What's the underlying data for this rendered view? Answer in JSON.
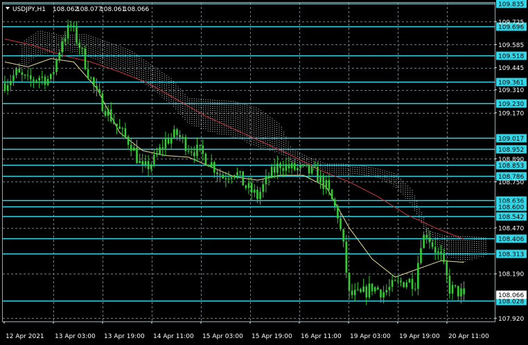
{
  "header": {
    "symbol_label": "USDJPY,H1",
    "ohlc": [
      "108.062",
      "108.077",
      "108.061",
      "108.066"
    ]
  },
  "colors": {
    "background": "#000000",
    "candles": "#33cc33",
    "grid": "#6e7f7f",
    "level_line": "#33d6e6",
    "level_label_bg": "#33d6e6",
    "price_label_bg": "#ffffff",
    "cloud": "#ffffff",
    "ma_fast": "#e8df8e",
    "ma_slow": "#cc3344"
  },
  "chart_data": {
    "type": "candlestick",
    "title": "",
    "xlabel": "",
    "ylabel": "",
    "ylim": [
      107.9,
      109.84
    ],
    "grid": true,
    "y_ticks": [
      "109.725",
      "109.585",
      "109.445",
      "109.310",
      "109.170",
      "108.890",
      "108.750",
      "108.470",
      "108.190",
      "107.920"
    ],
    "x_ticks": [
      "12 Apr 2021",
      "13 Apr 03:00",
      "13 Apr 19:00",
      "14 Apr 11:00",
      "15 Apr 03:00",
      "15 Apr 19:00",
      "16 Apr 11:00",
      "19 Apr 03:00",
      "19 Apr 19:00",
      "20 Apr 11:00"
    ],
    "levels": [
      {
        "label": "109.835",
        "value": 109.835
      },
      {
        "label": "109.696",
        "value": 109.696
      },
      {
        "label": "109.518",
        "value": 109.518
      },
      {
        "label": "109.361",
        "value": 109.361
      },
      {
        "label": "109.230",
        "value": 109.23
      },
      {
        "label": "109.017",
        "value": 109.017
      },
      {
        "label": "108.952",
        "value": 108.952
      },
      {
        "label": "108.853",
        "value": 108.853
      },
      {
        "label": "108.786",
        "value": 108.786
      },
      {
        "label": "108.636",
        "value": 108.636
      },
      {
        "label": "108.600",
        "value": 108.6
      },
      {
        "label": "108.542",
        "value": 108.542
      },
      {
        "label": "108.406",
        "value": 108.406
      },
      {
        "label": "108.313",
        "value": 108.313
      },
      {
        "label": "108.028",
        "value": 108.028
      }
    ],
    "current_price": {
      "label": "108.066",
      "value": 108.066
    },
    "close_path": [
      [
        0,
        109.35
      ],
      [
        4,
        109.41
      ],
      [
        8,
        109.36
      ],
      [
        12,
        109.39
      ],
      [
        16,
        109.37
      ],
      [
        20,
        109.62
      ],
      [
        23,
        109.7
      ],
      [
        26,
        109.58
      ],
      [
        29,
        109.42
      ],
      [
        32,
        109.28
      ],
      [
        36,
        109.17
      ],
      [
        40,
        109.06
      ],
      [
        44,
        108.98
      ],
      [
        48,
        108.82
      ],
      [
        52,
        108.88
      ],
      [
        56,
        109.0
      ],
      [
        60,
        109.04
      ],
      [
        64,
        108.96
      ],
      [
        68,
        108.93
      ],
      [
        72,
        108.86
      ],
      [
        76,
        108.78
      ],
      [
        80,
        108.82
      ],
      [
        84,
        108.72
      ],
      [
        88,
        108.66
      ],
      [
        92,
        108.78
      ],
      [
        96,
        108.86
      ],
      [
        100,
        108.83
      ],
      [
        104,
        108.82
      ],
      [
        108,
        108.8
      ],
      [
        112,
        108.72
      ],
      [
        116,
        108.55
      ],
      [
        118,
        108.35
      ],
      [
        120,
        108.06
      ],
      [
        124,
        108.06
      ],
      [
        128,
        108.11
      ],
      [
        132,
        108.08
      ],
      [
        136,
        108.12
      ],
      [
        140,
        108.15
      ],
      [
        143,
        108.14
      ],
      [
        145,
        108.39
      ],
      [
        147,
        108.44
      ],
      [
        149,
        108.37
      ],
      [
        152,
        108.28
      ],
      [
        155,
        108.1
      ],
      [
        158,
        108.08
      ],
      [
        160,
        108.066
      ]
    ],
    "ma_fast": [
      [
        0,
        109.48
      ],
      [
        8,
        109.45
      ],
      [
        16,
        109.5
      ],
      [
        24,
        109.48
      ],
      [
        32,
        109.32
      ],
      [
        40,
        109.05
      ],
      [
        48,
        108.94
      ],
      [
        56,
        108.91
      ],
      [
        64,
        108.9
      ],
      [
        72,
        108.84
      ],
      [
        80,
        108.78
      ],
      [
        88,
        108.76
      ],
      [
        96,
        108.79
      ],
      [
        104,
        108.79
      ],
      [
        112,
        108.72
      ],
      [
        120,
        108.47
      ],
      [
        128,
        108.28
      ],
      [
        136,
        108.17
      ],
      [
        144,
        108.22
      ],
      [
        152,
        108.27
      ],
      [
        160,
        108.26
      ]
    ],
    "ma_slow": [
      [
        0,
        109.62
      ],
      [
        10,
        109.58
      ],
      [
        20,
        109.52
      ],
      [
        30,
        109.48
      ],
      [
        40,
        109.42
      ],
      [
        50,
        109.35
      ],
      [
        60,
        109.25
      ],
      [
        70,
        109.15
      ],
      [
        80,
        109.07
      ],
      [
        90,
        108.99
      ],
      [
        100,
        108.91
      ],
      [
        110,
        108.82
      ],
      [
        120,
        108.75
      ],
      [
        130,
        108.66
      ],
      [
        140,
        108.55
      ],
      [
        150,
        108.47
      ],
      [
        160,
        108.4
      ]
    ],
    "cloud_upper": [
      [
        6,
        109.6
      ],
      [
        12,
        109.67
      ],
      [
        20,
        109.64
      ],
      [
        28,
        109.65
      ],
      [
        36,
        109.6
      ],
      [
        44,
        109.55
      ],
      [
        52,
        109.45
      ],
      [
        58,
        109.38
      ],
      [
        64,
        109.26
      ],
      [
        72,
        109.25
      ],
      [
        80,
        109.24
      ],
      [
        88,
        109.2
      ],
      [
        96,
        109.1
      ],
      [
        100,
        108.95
      ],
      [
        106,
        108.9
      ],
      [
        112,
        108.86
      ],
      [
        118,
        108.86
      ],
      [
        124,
        108.85
      ],
      [
        130,
        108.83
      ],
      [
        136,
        108.8
      ],
      [
        142,
        108.7
      ],
      [
        148,
        108.45
      ],
      [
        154,
        108.42
      ],
      [
        160,
        108.42
      ],
      [
        168,
        108.41
      ]
    ],
    "cloud_lower": [
      [
        6,
        109.44
      ],
      [
        12,
        109.52
      ],
      [
        20,
        109.55
      ],
      [
        28,
        109.52
      ],
      [
        36,
        109.45
      ],
      [
        44,
        109.4
      ],
      [
        52,
        109.3
      ],
      [
        58,
        109.22
      ],
      [
        64,
        109.1
      ],
      [
        72,
        109.05
      ],
      [
        80,
        109.02
      ],
      [
        88,
        108.96
      ],
      [
        96,
        108.92
      ],
      [
        100,
        108.86
      ],
      [
        106,
        108.83
      ],
      [
        112,
        108.8
      ],
      [
        118,
        108.79
      ],
      [
        124,
        108.79
      ],
      [
        130,
        108.77
      ],
      [
        136,
        108.72
      ],
      [
        142,
        108.6
      ],
      [
        148,
        108.4
      ],
      [
        154,
        108.3
      ],
      [
        160,
        108.26
      ],
      [
        168,
        108.3
      ]
    ]
  }
}
